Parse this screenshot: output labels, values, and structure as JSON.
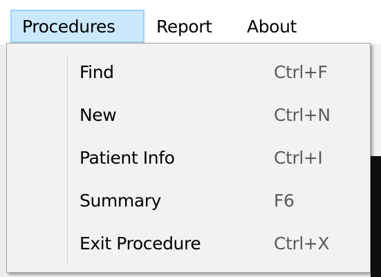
{
  "menubar": {
    "items": [
      {
        "label": "Procedures",
        "active": true
      },
      {
        "label": "Report"
      },
      {
        "label": "About"
      }
    ]
  },
  "dropdown": {
    "items": [
      {
        "label": "Find",
        "shortcut": "Ctrl+F"
      },
      {
        "label": "New",
        "shortcut": "Ctrl+N"
      },
      {
        "label": "Patient Info",
        "shortcut": "Ctrl+I"
      },
      {
        "label": "Summary",
        "shortcut": "F6"
      },
      {
        "label": "Exit Procedure",
        "shortcut": "Ctrl+X"
      }
    ]
  },
  "colors": {
    "active_menu_bg": "#cce8ff",
    "active_menu_border": "#99d1ff",
    "dropdown_bg": "#f2f2f2",
    "shortcut_text": "#5a5a5a"
  }
}
